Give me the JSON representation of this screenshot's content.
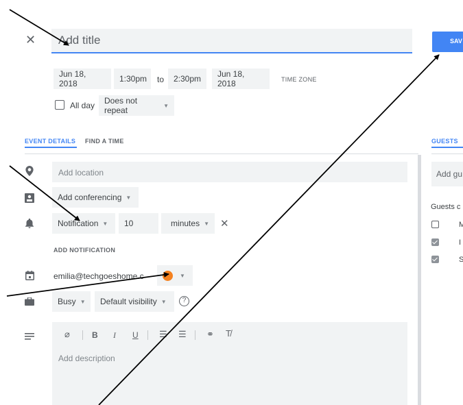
{
  "header": {
    "close_glyph": "✕",
    "title_placeholder": "Add title",
    "save_label": "SAV"
  },
  "datetime": {
    "start_date": "Jun 18, 2018",
    "start_time": "1:30pm",
    "to": "to",
    "end_time": "2:30pm",
    "end_date": "Jun 18, 2018",
    "time_zone": "TIME ZONE",
    "all_day": "All day",
    "repeat": "Does not repeat"
  },
  "tabs": {
    "event_details": "EVENT DETAILS",
    "find_a_time": "FIND A TIME",
    "guests": "GUESTS"
  },
  "details": {
    "location_placeholder": "Add location",
    "conferencing": "Add conferencing",
    "notification_type": "Notification",
    "notification_value": "10",
    "notification_unit": "minutes",
    "add_notification": "ADD NOTIFICATION",
    "calendar_email": "emilia@techgoeshome.c",
    "event_color": "#f4811f",
    "availability": "Busy",
    "visibility": "Default visibility",
    "help_glyph": "?",
    "description_placeholder": "Add description",
    "format_buttons": [
      "B",
      "I",
      "U"
    ]
  },
  "guests": {
    "add_placeholder": "Add gu",
    "guests_can": "Guests c",
    "options": [
      {
        "letter": "M",
        "checked": false
      },
      {
        "letter": "I",
        "checked": true
      },
      {
        "letter": "S",
        "checked": true
      }
    ]
  },
  "colors": {
    "accent": "#4285f4",
    "chip_bg": "#f1f3f4",
    "arrow": "#000000"
  }
}
